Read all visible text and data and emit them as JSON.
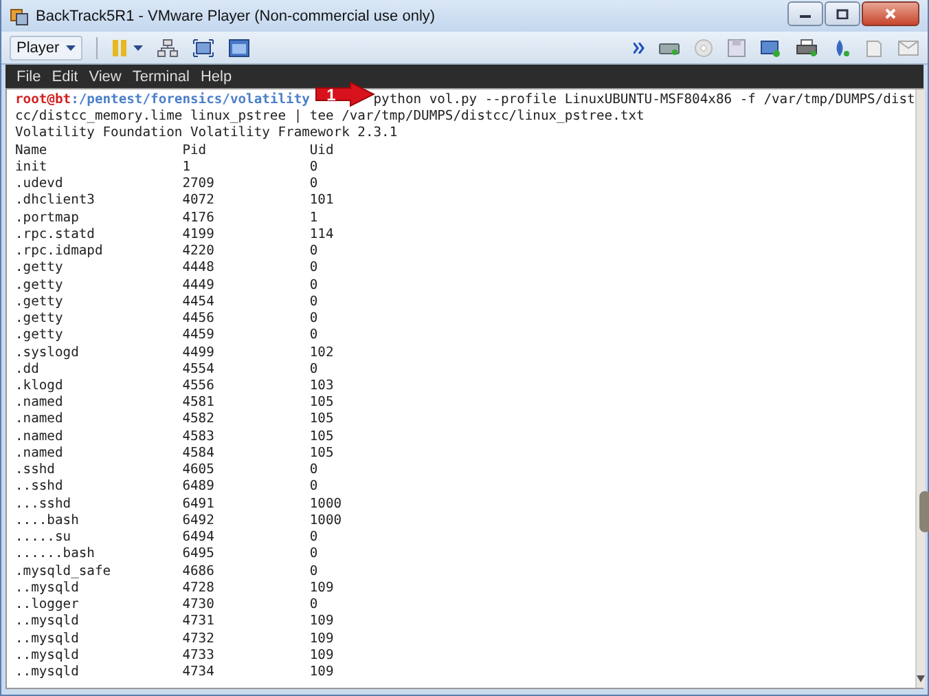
{
  "window": {
    "title": "BackTrack5R1 - VMware Player (Non-commercial use only)"
  },
  "toolbar": {
    "player_menu": "Player"
  },
  "terminal": {
    "menu": [
      "File",
      "Edit",
      "View",
      "Terminal",
      "Help"
    ],
    "prompt": {
      "user_host": "root@bt",
      "path": ":/pentest/forensics/volatility"
    },
    "command_lines": [
      "python vol.py --profile LinuxUBUNTU-MSF804x86 -f /var/tmp/DUMPS/dist",
      "cc/distcc_memory.lime linux_pstree | tee /var/tmp/DUMPS/distcc/linux_pstree.txt"
    ],
    "output": [
      "Volatility Foundation Volatility Framework 2.3.1"
    ],
    "table": {
      "columns": [
        "Name",
        "Pid",
        "Uid"
      ],
      "rows": [
        [
          "init",
          "1",
          "0"
        ],
        [
          ".udevd",
          "2709",
          "0"
        ],
        [
          ".dhclient3",
          "4072",
          "101"
        ],
        [
          ".portmap",
          "4176",
          "1"
        ],
        [
          ".rpc.statd",
          "4199",
          "114"
        ],
        [
          ".rpc.idmapd",
          "4220",
          "0"
        ],
        [
          ".getty",
          "4448",
          "0"
        ],
        [
          ".getty",
          "4449",
          "0"
        ],
        [
          ".getty",
          "4454",
          "0"
        ],
        [
          ".getty",
          "4456",
          "0"
        ],
        [
          ".getty",
          "4459",
          "0"
        ],
        [
          ".syslogd",
          "4499",
          "102"
        ],
        [
          ".dd",
          "4554",
          "0"
        ],
        [
          ".klogd",
          "4556",
          "103"
        ],
        [
          ".named",
          "4581",
          "105"
        ],
        [
          ".named",
          "4582",
          "105"
        ],
        [
          ".named",
          "4583",
          "105"
        ],
        [
          ".named",
          "4584",
          "105"
        ],
        [
          ".sshd",
          "4605",
          "0"
        ],
        [
          "..sshd",
          "6489",
          "0"
        ],
        [
          "...sshd",
          "6491",
          "1000"
        ],
        [
          "....bash",
          "6492",
          "1000"
        ],
        [
          ".....su",
          "6494",
          "0"
        ],
        [
          "......bash",
          "6495",
          "0"
        ],
        [
          ".mysqld_safe",
          "4686",
          "0"
        ],
        [
          "..mysqld",
          "4728",
          "109"
        ],
        [
          "..logger",
          "4730",
          "0"
        ],
        [
          "..mysqld",
          "4731",
          "109"
        ],
        [
          "..mysqld",
          "4732",
          "109"
        ],
        [
          "..mysqld",
          "4733",
          "109"
        ],
        [
          "..mysqld",
          "4734",
          "109"
        ]
      ]
    }
  },
  "annotation": {
    "badge": "1"
  }
}
